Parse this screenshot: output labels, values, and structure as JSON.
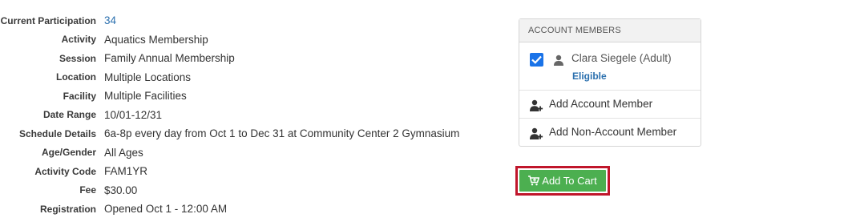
{
  "details": [
    {
      "label": "Current Participation",
      "value": "34",
      "link": true
    },
    {
      "label": "Activity",
      "value": "Aquatics Membership"
    },
    {
      "label": "Session",
      "value": "Family Annual Membership"
    },
    {
      "label": "Location",
      "value": "Multiple Locations"
    },
    {
      "label": "Facility",
      "value": "Multiple Facilities"
    },
    {
      "label": "Date Range",
      "value": "10/01-12/31"
    },
    {
      "label": "Schedule Details",
      "value": "6a-8p every day from Oct 1 to Dec 31 at Community Center 2 Gymnasium"
    },
    {
      "label": "Age/Gender",
      "value": "All Ages"
    },
    {
      "label": "Activity Code",
      "value": "FAM1YR"
    },
    {
      "label": "Fee",
      "value": "$30.00"
    },
    {
      "label": "Registration",
      "value": "Opened Oct 1 - 12:00 AM"
    }
  ],
  "account_members": {
    "heading": "ACCOUNT MEMBERS",
    "members": [
      {
        "name": "Clara Siegele (Adult)",
        "status": "Eligible",
        "checked": true
      }
    ],
    "add_account_member": "Add Account Member",
    "add_non_account_member": "Add Non-Account Member"
  },
  "cart": {
    "label": "Add To Cart",
    "button_color": "#4caf50",
    "highlight_color": "#c0162b"
  },
  "colors": {
    "link": "#2a6fae",
    "checkbox": "#1a73e8"
  }
}
